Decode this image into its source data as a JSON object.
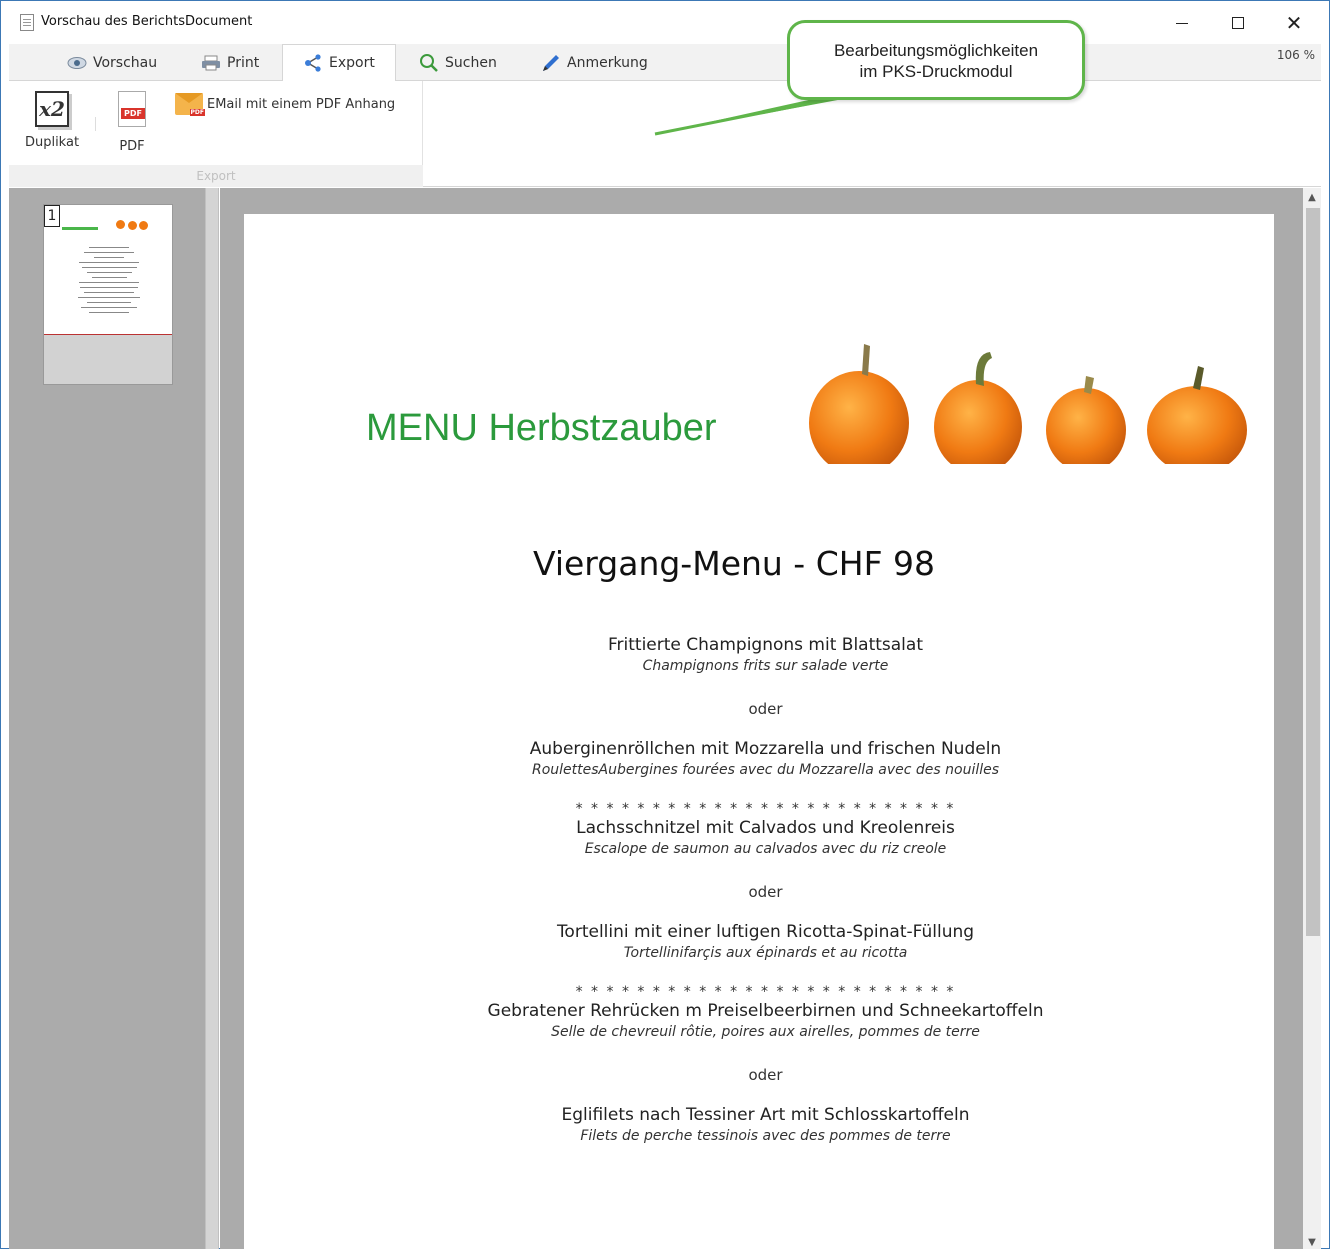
{
  "window": {
    "title": "Vorschau des BerichtsDocument",
    "minimize_icon": "minimize-icon",
    "maximize_icon": "maximize-icon",
    "close_glyph": "✕"
  },
  "ribbon_tabs": [
    {
      "label": "Vorschau",
      "icon": "eye-icon"
    },
    {
      "label": "Print",
      "icon": "printer-icon"
    },
    {
      "label": "Export",
      "icon": "share-icon",
      "active": true
    },
    {
      "label": "Suchen",
      "icon": "search-icon"
    },
    {
      "label": "Anmerkung",
      "icon": "pen-icon"
    }
  ],
  "zoom": "106 %",
  "export_group": {
    "label": "Export",
    "duplicate_label": "Duplikat",
    "duplicate_glyph": "x2",
    "pdf_label": "PDF",
    "pdf_badge": "PDF",
    "email_label": "EMail mit einem PDF Anhang",
    "email_badge": "PDF"
  },
  "callout": {
    "line1": "Bearbeitungsmöglichkeiten",
    "line2": "im PKS-Druckmodul",
    "border_color": "#5fb54a"
  },
  "thumbnail": {
    "page_number": "1"
  },
  "document": {
    "menu_title": "MENU Herbstzauber",
    "menu_title_color": "#2b9a3c",
    "heading": "Viergang-Menu - CHF 98",
    "separator": "* * * * * * * * * * * * * * * * * * * * * * * * *",
    "or": "oder",
    "courses": [
      {
        "de": "Frittierte Champignons mit Blattsalat",
        "fr": "Champignons frits sur salade verte"
      },
      {
        "de": "Auberginenröllchen mit Mozzarella und frischen Nudeln",
        "fr": "RoulettesAubergines fourées avec du Mozzarella avec des nouilles"
      },
      {
        "de": "Lachsschnitzel mit Calvados und Kreolenreis",
        "fr": "Escalope de saumon au calvados avec du riz creole"
      },
      {
        "de": "Tortellini mit einer  luftigen Ricotta-Spinat-Füllung",
        "fr": "Tortellinifarçis aux épinards et au ricotta"
      },
      {
        "de": "Gebratener Rehrücken m Preiselbeerbirnen und Schneekartoffeln",
        "fr": "Selle de chevreuil rôtie, poires aux airelles, pommes de terre"
      },
      {
        "de": "Eglifilets nach Tessiner Art mit Schlosskartoffeln",
        "fr": "Filets de perche tessinois avec des pommes de terre"
      }
    ],
    "pumpkin_color": "#f07a13"
  }
}
